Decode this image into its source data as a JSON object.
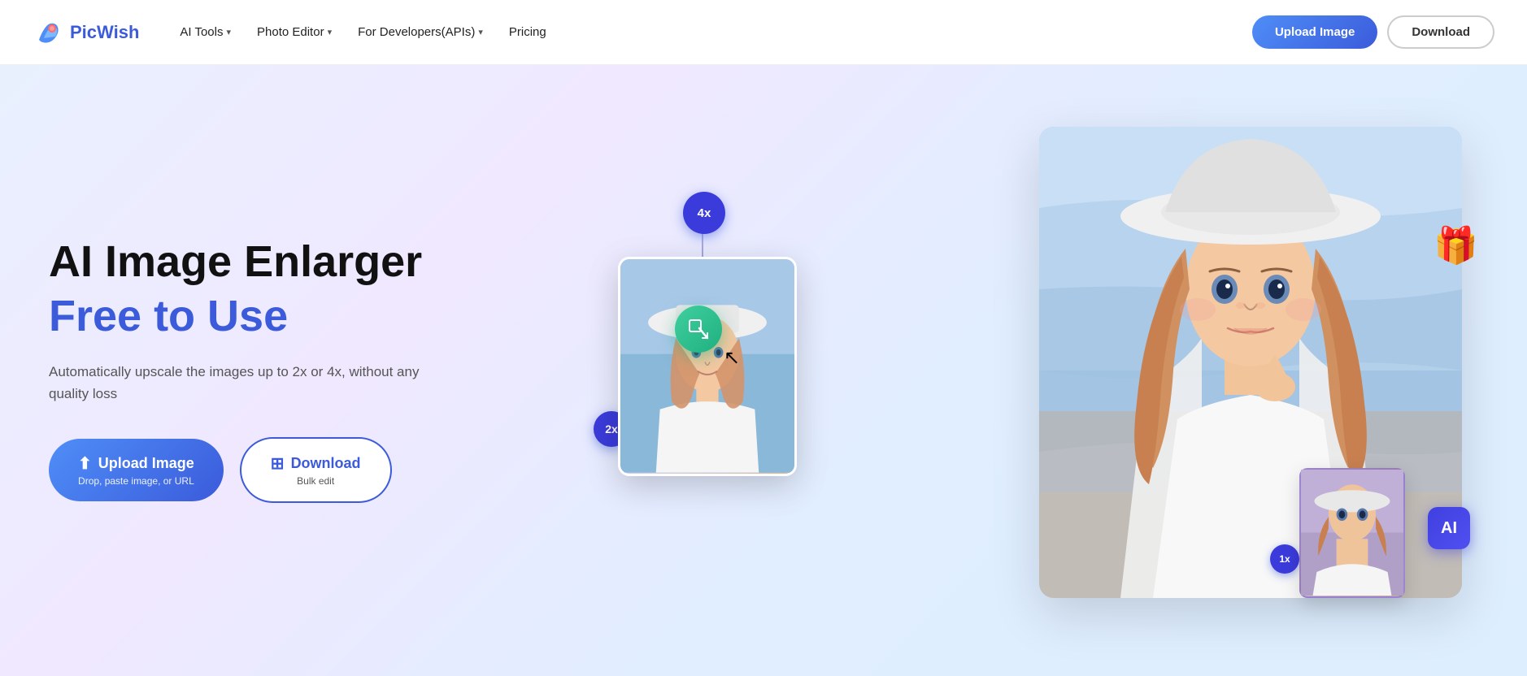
{
  "brand": {
    "name": "PicWish",
    "logo_alt": "PicWish logo"
  },
  "nav": {
    "items": [
      {
        "label": "AI Tools",
        "has_dropdown": true
      },
      {
        "label": "Photo Editor",
        "has_dropdown": true
      },
      {
        "label": "For Developers(APIs)",
        "has_dropdown": true
      },
      {
        "label": "Pricing",
        "has_dropdown": false
      }
    ],
    "upload_btn": "Upload Image",
    "download_btn": "Download"
  },
  "hero": {
    "title": "AI Image Enlarger",
    "subtitle": "Free to Use",
    "description": "Automatically upscale the images up to 2x or 4x, without any quality loss",
    "upload_btn_label": "Upload Image",
    "upload_btn_sub": "Drop, paste image, or URL",
    "download_btn_label": "Download",
    "download_btn_sub": "Bulk edit"
  },
  "badges": {
    "four_x": "4x",
    "two_x": "2x",
    "one_x": "1x"
  },
  "ai_label": "AI"
}
